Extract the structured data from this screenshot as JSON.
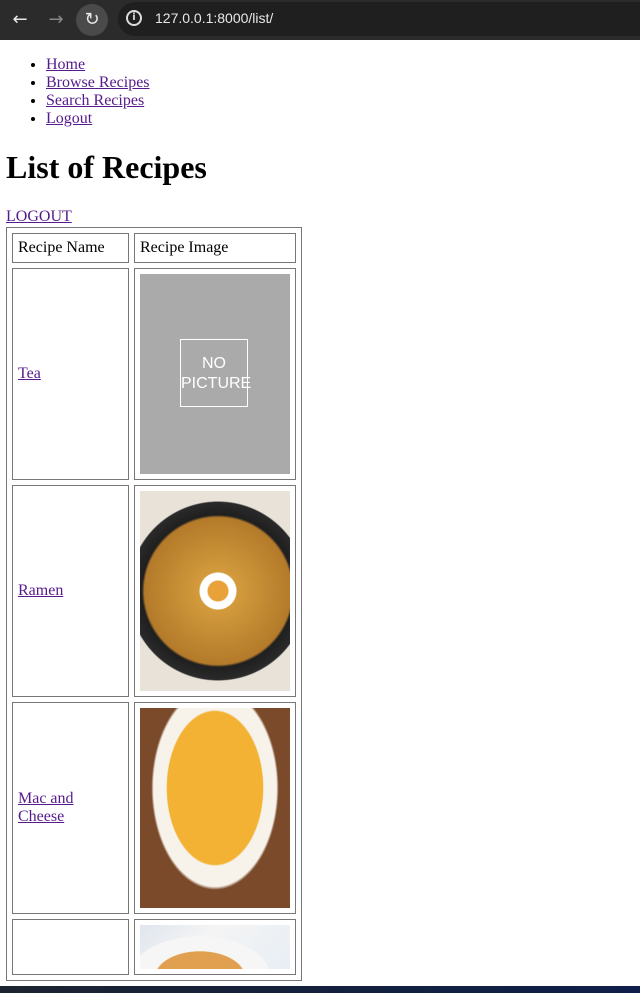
{
  "browser": {
    "url": "127.0.0.1:8000/list/",
    "back_icon": "arrow-left",
    "forward_icon": "arrow-right",
    "reload_icon": "reload",
    "info_icon": "info"
  },
  "nav": {
    "items": [
      {
        "label": "Home"
      },
      {
        "label": "Browse Recipes"
      },
      {
        "label": "Search Recipes"
      },
      {
        "label": "Logout"
      }
    ]
  },
  "page": {
    "title": "List of Recipes",
    "logout_label": "LOGOUT"
  },
  "table": {
    "headers": [
      "Recipe Name",
      "Recipe Image"
    ],
    "rows": [
      {
        "name": "Tea",
        "image": "no-picture",
        "image_text": "NO PICTURE"
      },
      {
        "name": "Ramen",
        "image": "ramen-photo"
      },
      {
        "name": "Mac and Cheese",
        "image": "mac-and-cheese-photo"
      },
      {
        "name": "",
        "image": "recipe-photo"
      }
    ]
  }
}
